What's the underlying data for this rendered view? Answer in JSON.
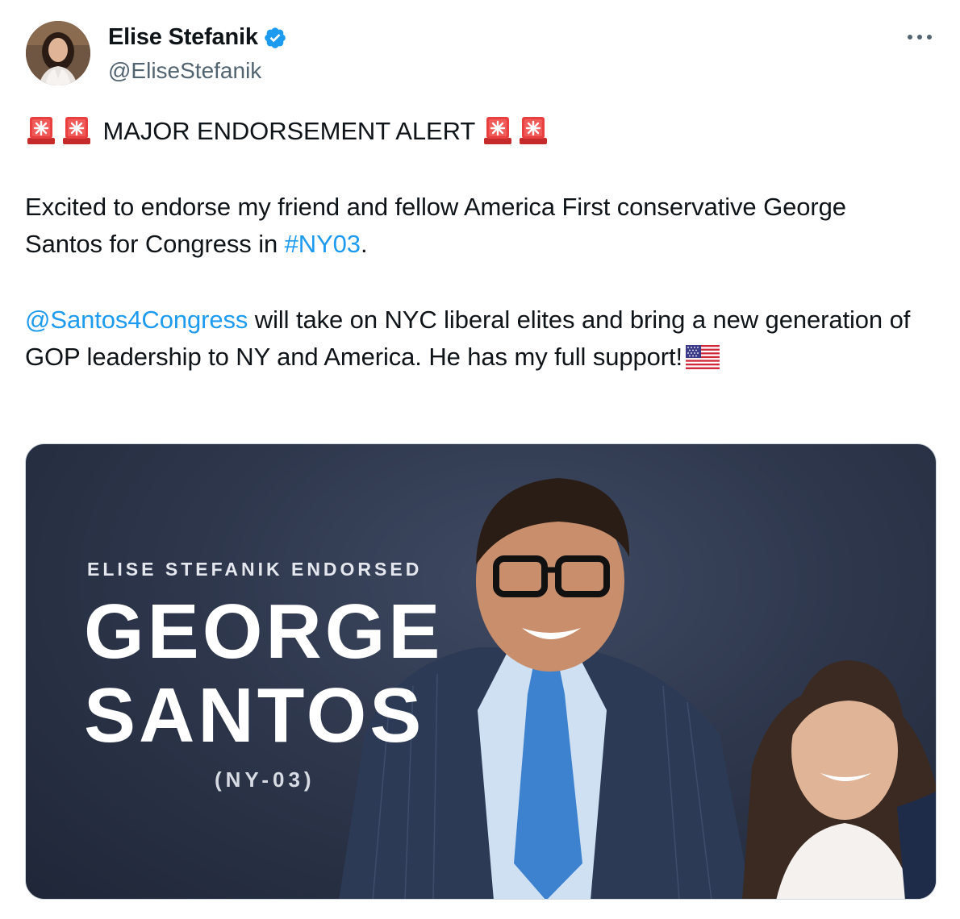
{
  "tweet": {
    "author": {
      "display_name": "Elise Stefanik",
      "handle": "@EliseStefanik",
      "verified": true,
      "avatar_icon": "profile-photo"
    },
    "more_icon": "more-dots-icon",
    "text": {
      "line1_emoji_left": [
        "police-siren-emoji",
        "police-siren-emoji"
      ],
      "line1": "MAJOR ENDORSEMENT ALERT",
      "line1_emoji_right": [
        "police-siren-emoji",
        "police-siren-emoji"
      ],
      "para2_prefix": "Excited to endorse my friend and fellow America First conservative George Santos for Congress in ",
      "para2_hashtag": "#NY03",
      "para2_suffix": ".",
      "para3_mention": "@Santos4Congress",
      "para3_text": " will take on NYC liberal elites and bring a new generation of GOP leadership to NY and America. He has my full support!",
      "para3_emoji": "us-flag-emoji"
    },
    "media": {
      "kicker": "ELISE STEFANIK ENDORSED",
      "name_line1": "GEORGE",
      "name_line2": "SANTOS",
      "district": "(NY-03)"
    }
  },
  "colors": {
    "text": "#0f1419",
    "secondary": "#536471",
    "link": "#1d9bf0",
    "verified": "#1d9bf0",
    "media_bg": "#2e374c"
  }
}
